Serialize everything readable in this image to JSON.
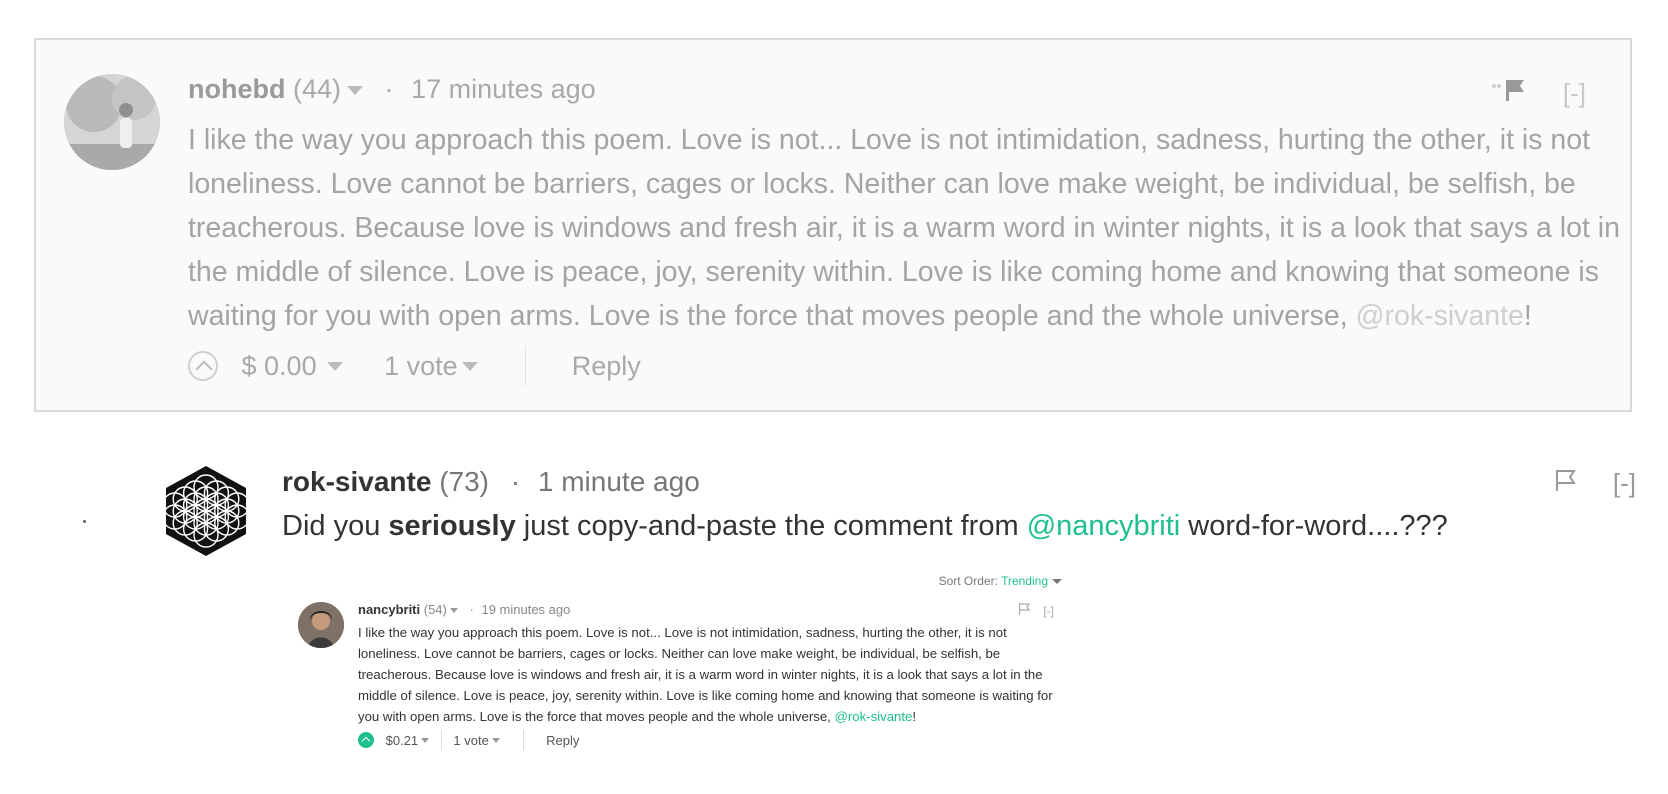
{
  "comment_parent": {
    "author": "nohebd",
    "reputation": "(44)",
    "time": "17 minutes ago",
    "body_text": "I like the way you approach this poem. Love is not... Love is not intimidation, sadness, hurting the other, it is not loneliness. Love cannot be barriers, cages or locks. Neither can love make weight, be individual, be selfish, be treacherous. Because love is windows and fresh air, it is a warm word in winter nights, it is a look that says a lot in the middle of silence. Love is peace, joy, serenity within. Love is like coming home and knowing that someone is waiting for you with open arms. Love is the force that moves people and the whole universe, ",
    "mention": "@rok-sivante",
    "body_end": "!",
    "payout": "$ 0.00",
    "votes": "1 vote",
    "reply": "Reply",
    "collapse": "[-]"
  },
  "comment_reply": {
    "author": "rok-sivante",
    "reputation": "(73)",
    "time": "1 minute ago",
    "body_pre": "Did you ",
    "body_bold": "seriously",
    "body_mid": " just copy-and-paste the comment from ",
    "mention": "@nancybriti",
    "body_post": " word-for-word....???",
    "collapse": "[-]"
  },
  "embedded_screenshot": {
    "sort_label": "Sort Order:",
    "sort_value": "Trending",
    "author": "nancybriti",
    "reputation": "(54)",
    "time": "19 minutes ago",
    "body_text": "I like the way you approach this poem. Love is not... Love is not intimidation, sadness, hurting the other, it is not loneliness. Love cannot be barriers, cages or locks. Neither can love make weight, be individual, be selfish, be treacherous. Because love is windows and fresh air, it is a warm word in winter nights, it is a look that says a lot in the middle of silence. Love is peace, joy, serenity within. Love is like coming home and knowing that someone is waiting for you with open arms. Love is the force that moves people and the whole universe, ",
    "mention": "@rok-sivante",
    "body_end": "!",
    "payout": "$0.21",
    "votes": "1 vote",
    "reply": "Reply",
    "collapse": "[-]"
  }
}
